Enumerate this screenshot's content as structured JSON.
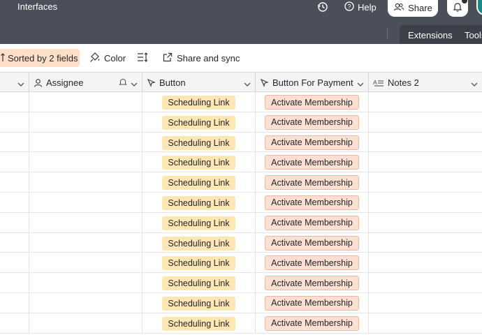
{
  "topbar": {
    "interfaces_label": "Interfaces",
    "help_label": "Help",
    "share_label": "Share"
  },
  "subbar": {
    "extensions_label": "Extensions",
    "tools_label": "Tools"
  },
  "toolbar": {
    "sorted_label": "Sorted by 2 fields",
    "color_label": "Color",
    "share_sync_label": "Share and sync"
  },
  "columns": {
    "assignee": "Assignee",
    "button": "Button",
    "button_for_payment": "Button For Payment",
    "notes2": "Notes 2"
  },
  "rows": [
    {
      "button": "Scheduling Link",
      "payment": "Activate Membership"
    },
    {
      "button": "Scheduling Link",
      "payment": "Activate Membership"
    },
    {
      "button": "Scheduling Link",
      "payment": "Activate Membership"
    },
    {
      "button": "Scheduling Link",
      "payment": "Activate Membership"
    },
    {
      "button": "Scheduling Link",
      "payment": "Activate Membership"
    },
    {
      "button": "Scheduling Link",
      "payment": "Activate Membership"
    },
    {
      "button": "Scheduling Link",
      "payment": "Activate Membership"
    },
    {
      "button": "Scheduling Link",
      "payment": "Activate Membership"
    },
    {
      "button": "Scheduling Link",
      "payment": "Activate Membership"
    },
    {
      "button": "Scheduling Link",
      "payment": "Activate Membership"
    },
    {
      "button": "Scheduling Link",
      "payment": "Activate Membership"
    },
    {
      "button": "Scheduling Link",
      "payment": "Activate Membership"
    }
  ],
  "colors": {
    "topbar_bg": "#4a4f59",
    "sorted_bg": "#ffdfc8",
    "scheduling_chip": "#ffe7b3",
    "payment_chip": "#fde0d2"
  }
}
